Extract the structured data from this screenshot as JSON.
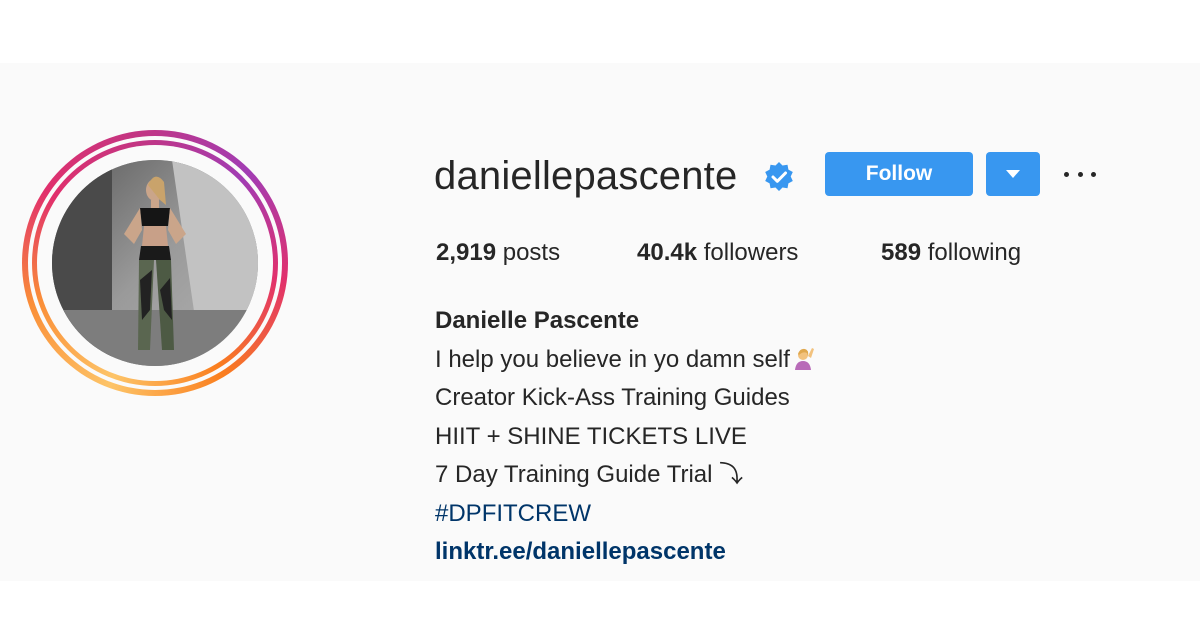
{
  "profile": {
    "username": "daniellepascente",
    "verified_icon": "verified-badge-icon",
    "follow_label": "Follow",
    "dropdown_icon": "caret-down-icon",
    "more_icon": "more-options-icon"
  },
  "stats": {
    "posts_count": "2,919",
    "posts_label": "posts",
    "followers_count": "40.4k",
    "followers_label": "followers",
    "following_count": "589",
    "following_label": "following"
  },
  "bio": {
    "full_name": "Danielle Pascente",
    "line1": "I help you believe in yo damn self",
    "line1_emoji": "person-raising-hand-icon",
    "line2": "Creator Kick-Ass Training Guides",
    "line3": "HIIT + SHINE TICKETS LIVE",
    "line4": "7 Day Training Guide Trial ⤵",
    "hashtag": "#DPFITCREW",
    "link": "linktr.ee/daniellepascente"
  },
  "colors": {
    "primary_button": "#3897f0",
    "link": "#003569",
    "text": "#262626",
    "background": "#fafafa"
  }
}
